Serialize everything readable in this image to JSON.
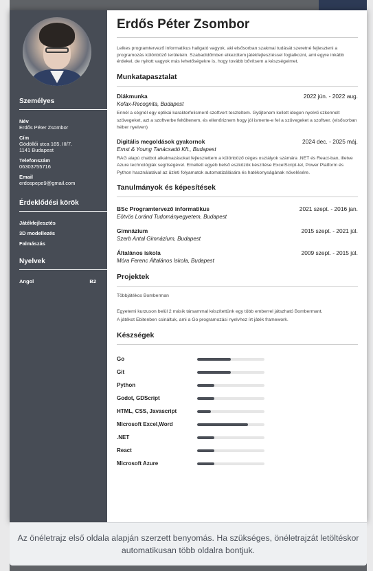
{
  "cv": {
    "name": "Erdős Péter Zsombor",
    "summary": "Lelkes programtervező informatikus hallgató vagyok, aki elsősorban szakmai tudását szeretné fejleszteni a programozás különböző területein. Szabadidőmben elkezdtem játékfejlesztéssel foglalkozni, ami egyre inkább érdekel, de nyitott vagyok más lehetőségekre is, hogy tovább bővítsem a készségeimet.",
    "personal": {
      "heading": "Személyes",
      "name_label": "Név",
      "name_value": "Erdős Péter Zsombor",
      "address_label": "Cím",
      "address_line1": "Gödöllői utca 165. III/7.",
      "address_line2": "1141 Budapest",
      "phone_label": "Telefonszám",
      "phone_value": "06303755716",
      "email_label": "Email",
      "email_value": "erdospepe9@gmail.com"
    },
    "interests": {
      "heading": "Érdeklődési körök",
      "items": [
        "Játékfejlesztés",
        "3D modellezés",
        "Falmászás"
      ]
    },
    "languages": {
      "heading": "Nyelvek",
      "items": [
        {
          "name": "Angol",
          "level": "B2"
        }
      ]
    },
    "experience": {
      "heading": "Munkatapasztalat",
      "items": [
        {
          "title": "Diákmunka",
          "date": "2022 jún. - 2022 aug.",
          "org": "Kofax-Recognita, Budapest",
          "desc": "Ennél a cégnél egy optikai karakterfelismerő szoftvert teszteltem. Gyűjtenem kellett idegen nyelvű szkennelt szövegeket, azt a szoftverbe feltöltenem, és ellenőriznem hogy jól ismerte-e fel a szövegeket a szoftver. (elsősorban héber nyelven)"
        },
        {
          "title": "Digitális megoldások gyakornok",
          "date": "2024 dec. - 2025 máj.",
          "org": "Ernst & Young Tanácsadó Kft., Budapest",
          "desc": "RAG alapú chatbot alkalmazásokat fejlesztettem a különböző céges osztályok számára .NET és React-ban, illetve Azure technológiák segítségével. Emellett egyéb belső eszközök készítése ExcelScript-tel, Power Platform és Python használatával az üzleti folyamatok automatizálására és hatékonyságának növelésére."
        }
      ]
    },
    "education": {
      "heading": "Tanulmányok és képesítések",
      "items": [
        {
          "title": "BSc Programtervező informatikus",
          "date": "2021 szept. - 2016 jan.",
          "org": "Eötvös Loránd Tudományegyetem, Budapest"
        },
        {
          "title": "Gimnázium",
          "date": "2015 szept. - 2021 júl.",
          "org": "Szerb Antal Gimnázium, Budapest"
        },
        {
          "title": "Általános iskola",
          "date": "2009 szept. - 2015 júl.",
          "org": "Móra Ferenc Általános Iskola, Budapest"
        }
      ]
    },
    "projects": {
      "heading": "Projektek",
      "title": "Többjátékos Bomberman",
      "desc1": "Egyetemi kurzuson belül 2 másik társammal készítettünk egy több emberrel játszható Bombermant.",
      "desc2": "A játékot Ebitenben csináltuk, ami a Go programozási nyelvhez írt játék framework."
    },
    "skills": {
      "heading": "Készségek",
      "items": [
        {
          "name": "Go",
          "level": 0.5
        },
        {
          "name": "Git",
          "level": 0.5
        },
        {
          "name": "Python",
          "level": 0.25
        },
        {
          "name": "Godot, GDScript",
          "level": 0.25
        },
        {
          "name": "HTML, CSS, Javascript",
          "level": 0.2
        },
        {
          "name": "Microsoft Excel,Word",
          "level": 0.75
        },
        {
          "name": ".NET",
          "level": 0.25
        },
        {
          "name": "React",
          "level": 0.25
        },
        {
          "name": "Microsoft Azure",
          "level": 0.25
        }
      ]
    }
  },
  "notice": {
    "line1": "Az önéletrajz első oldala alapján szerzett benyomás. Ha szükséges, önéletrajzát letöltéskor",
    "line2": "automatikusan több oldalra bontjuk."
  }
}
